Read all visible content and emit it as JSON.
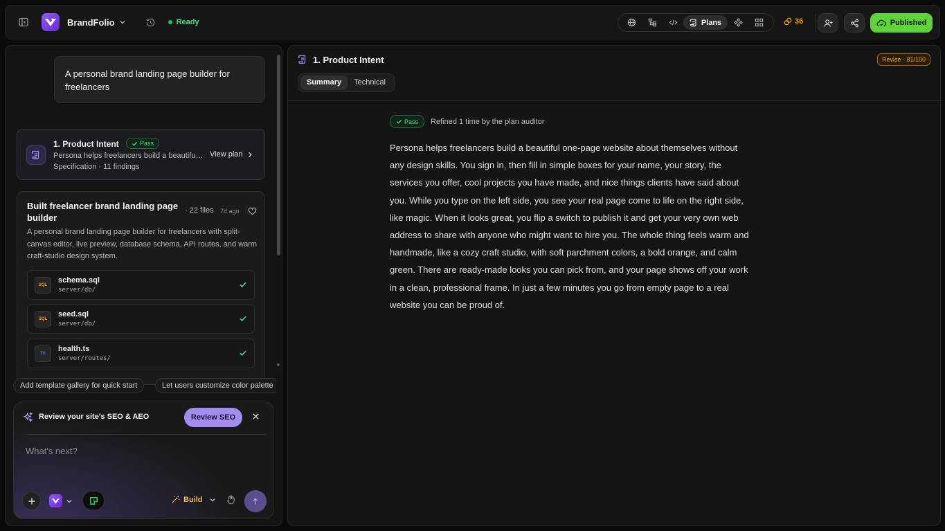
{
  "header": {
    "brand": "BrandFolio",
    "status": "Ready",
    "plans_label": "Plans",
    "credits": "36",
    "publish_label": "Published"
  },
  "colors": {
    "accent": "#8b5cf6",
    "success": "#4ade80",
    "publish": "#5ed33a",
    "warning": "#f59e0b"
  },
  "chat": {
    "user_message": "A personal brand landing page builder for freelancers",
    "intent_card": {
      "title": "1. Product Intent",
      "badge": "Pass",
      "description": "Persona helps freelancers build a beautiful one-page website about themselves without any design skills.",
      "meta": "Specification · 11 findings",
      "view_label": "View plan"
    },
    "build_card": {
      "title": "Built freelancer brand landing page builder",
      "files": "· 22 files",
      "time": "7d ago",
      "description": "A personal brand landing page builder for freelancers with split-canvas editor, live preview, database schema, API routes, and warm craft-studio design system.",
      "file_list": [
        {
          "name": "schema.sql",
          "path": "server/db/",
          "icon": "sql-file-icon",
          "badge": "SQL"
        },
        {
          "name": "seed.sql",
          "path": "server/db/",
          "icon": "sql-file-icon",
          "badge": "SQL"
        },
        {
          "name": "health.ts",
          "path": "server/routes/",
          "icon": "ts-file-icon",
          "badge": "TS"
        }
      ]
    },
    "suggestions": [
      "Add template gallery for quick start",
      "Let users customize color palette"
    ]
  },
  "composer": {
    "seo_prompt": "Review your site's SEO & AEO",
    "seo_button": "Review SEO",
    "placeholder": "What's next?",
    "mode_label": "Build"
  },
  "plan": {
    "title": "1. Product Intent",
    "revise_badge": "Revise · 81/100",
    "tabs": [
      "Summary",
      "Technical"
    ],
    "audit_badge": "Pass",
    "audit_text": "Refined 1 time by the plan auditor",
    "summary": "Persona helps freelancers build a beautiful one-page website about themselves without any design skills. You sign in, then fill in simple boxes for your name, your story, the services you offer, cool projects you have made, and nice things clients have said about you. While you type on the left side, you see your real page come to life on the right side, like magic. When it looks great, you flip a switch to publish it and get your very own web address to share with anyone who might want to hire you. The whole thing feels warm and handmade, like a cozy craft studio, with soft parchment colors, a bold orange, and calm green. There are ready-made looks you can pick from, and your page shows off your work in a clean, professional frame. In just a few minutes you go from empty page to a real website you can be proud of."
  }
}
